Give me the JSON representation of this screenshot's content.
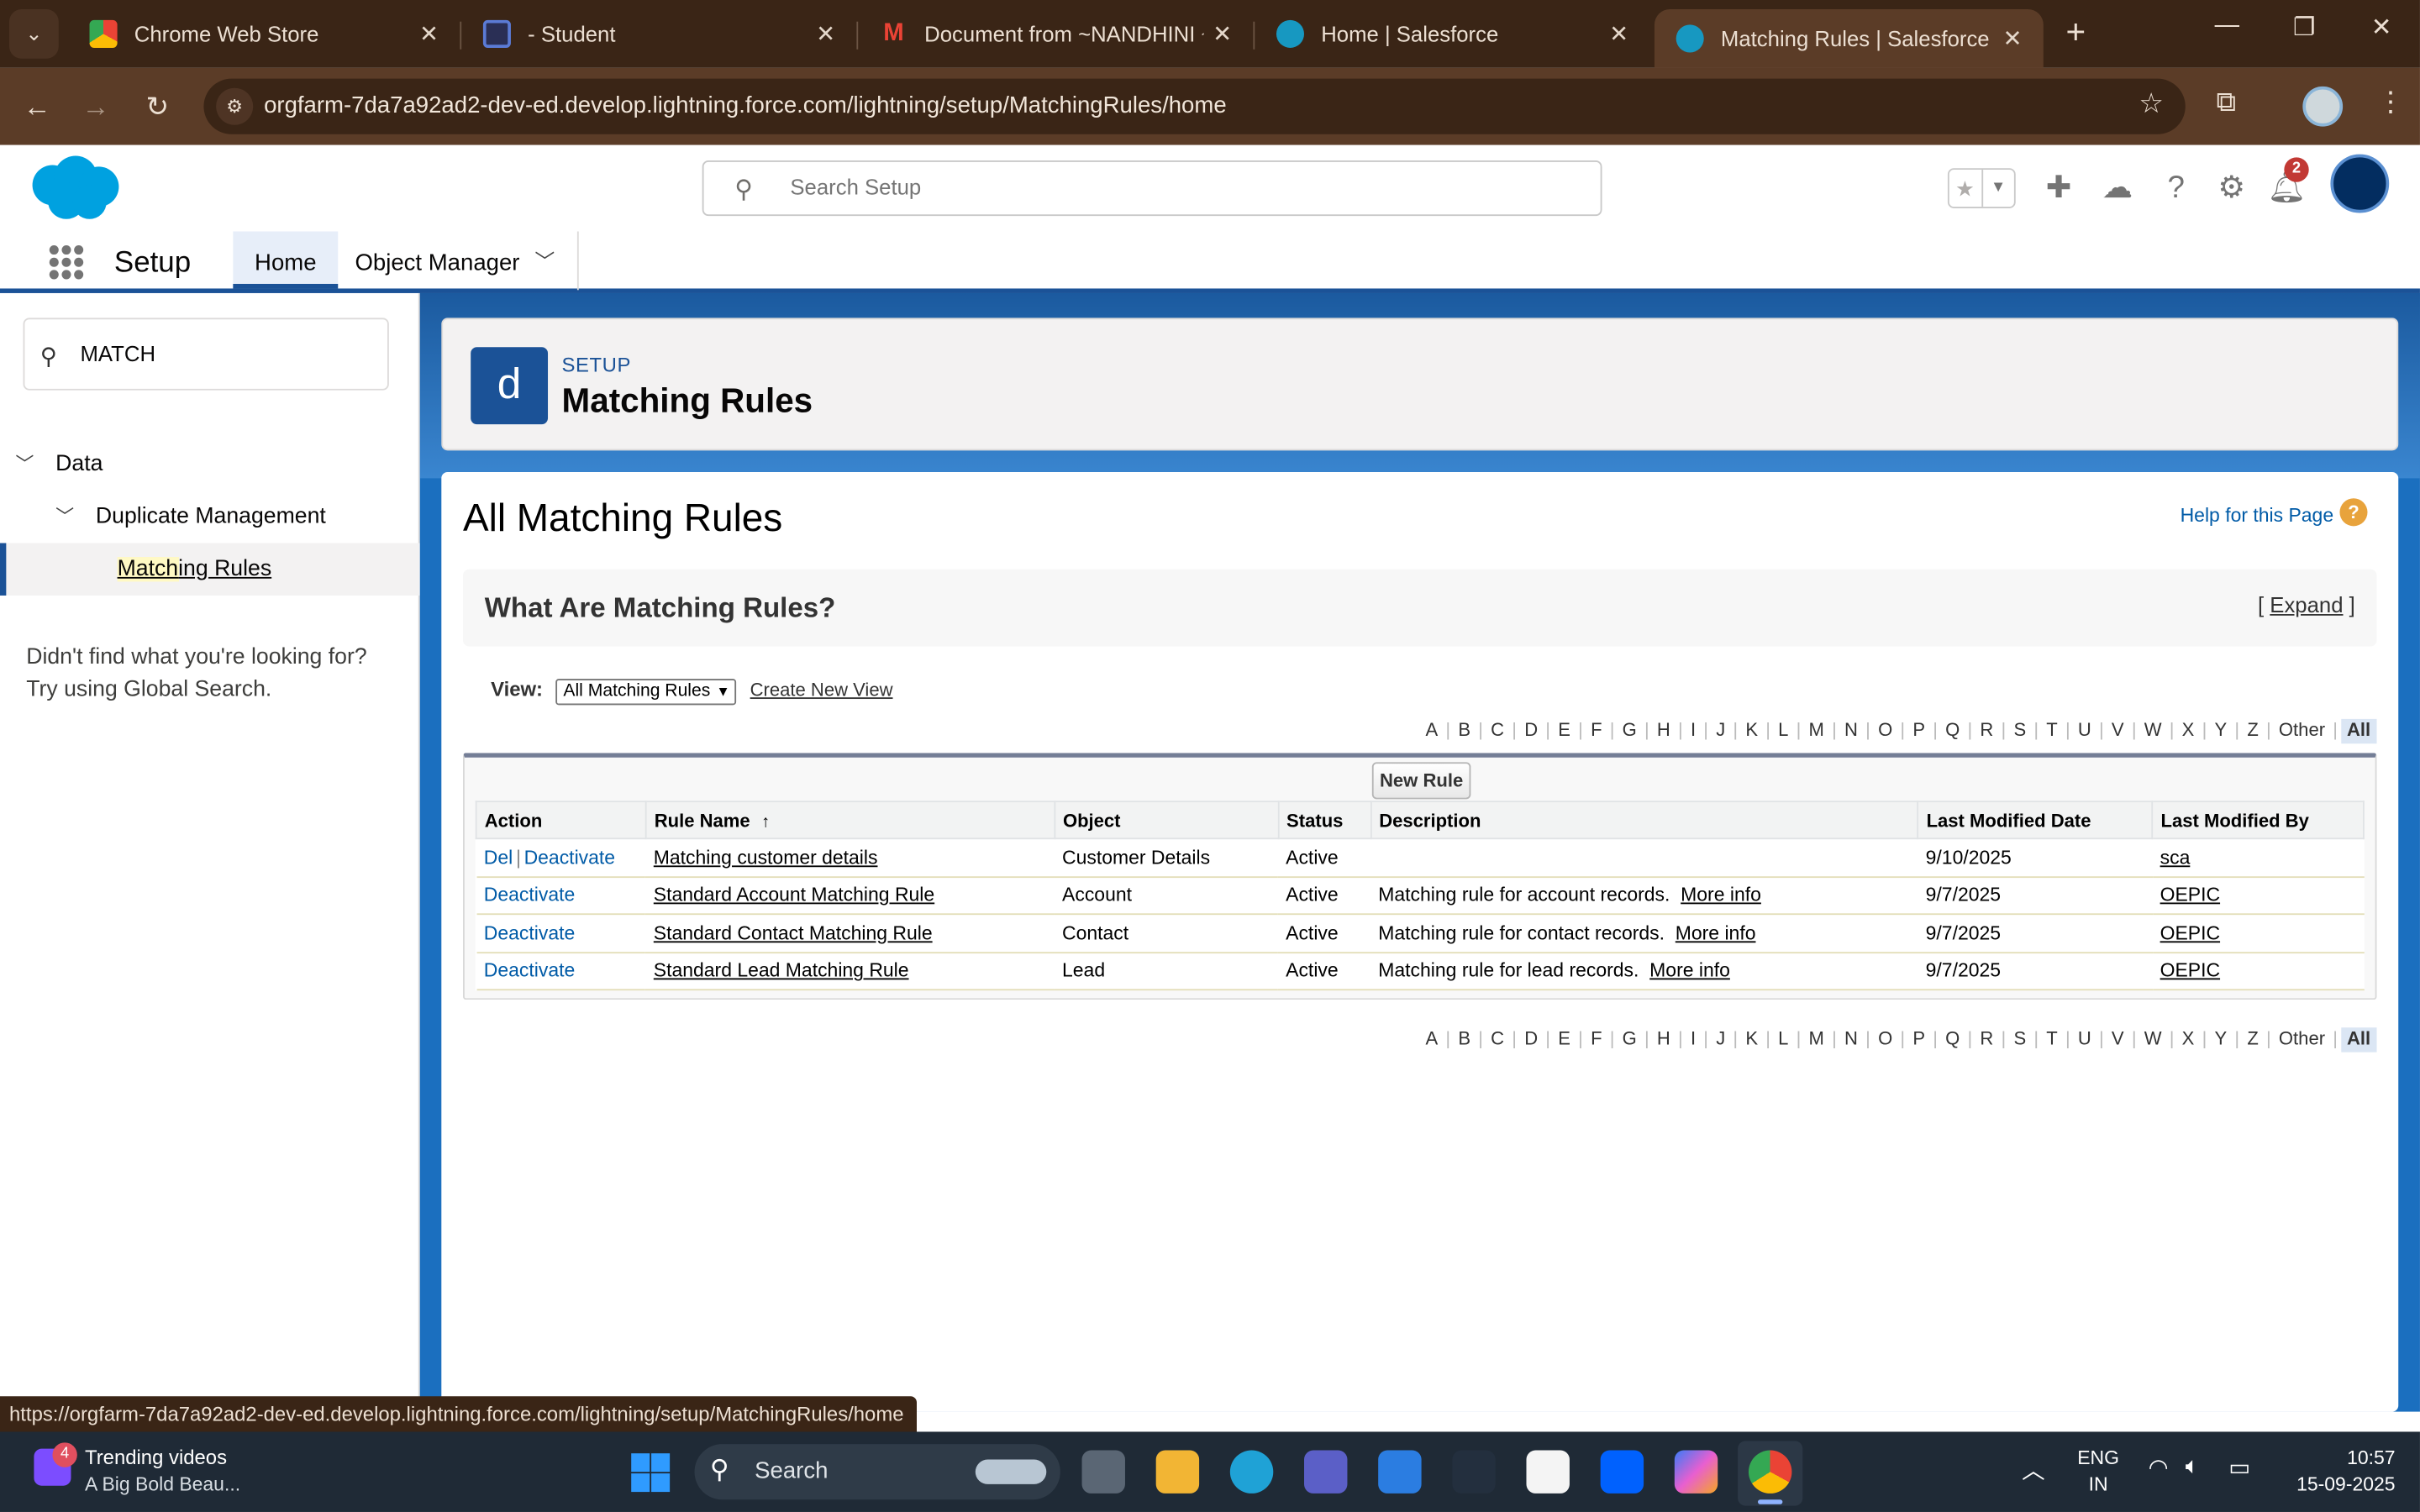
{
  "browser": {
    "tabs": [
      {
        "title": "Chrome Web Store",
        "favicon": "chrome-webstore-icon",
        "active": false
      },
      {
        "title": "- Student",
        "favicon": "student-app-icon",
        "active": false
      },
      {
        "title": "Document from ~NANDHINI ~",
        "favicon": "gmail-icon",
        "active": false
      },
      {
        "title": "Home | Salesforce",
        "favicon": "salesforce-cloud-icon",
        "active": false
      },
      {
        "title": "Matching Rules | Salesforce",
        "favicon": "salesforce-cloud-icon",
        "active": true
      }
    ],
    "url": "orgfarm-7da7a92ad2-dev-ed.develop.lightning.force.com/lightning/setup/MatchingRules/home",
    "status_url": "https://orgfarm-7da7a92ad2-dev-ed.develop.lightning.force.com/lightning/setup/MatchingRules/home"
  },
  "header": {
    "search_placeholder": "Search Setup",
    "notification_count": "2",
    "brand_color": "#1b5297"
  },
  "context_nav": {
    "app_name": "Setup",
    "tabs": [
      {
        "label": "Home",
        "active": true
      },
      {
        "label": "Object Manager",
        "active": false
      }
    ]
  },
  "setup_tree": {
    "quickfind_value": "MATCH",
    "items": [
      {
        "label": "Data",
        "level": 0,
        "expanded": true
      },
      {
        "label": "Duplicate Management",
        "level": 1,
        "expanded": true
      },
      {
        "label_highlight": "Match",
        "label_rest": "ing Rules",
        "level": 2,
        "selected": true
      }
    ],
    "not_found_line1": "Didn't find what you're looking for?",
    "not_found_line2": "Try using Global Search."
  },
  "page_header": {
    "icon_letter": "d",
    "eyebrow": "SETUP",
    "title": "Matching Rules"
  },
  "content": {
    "heading": "All Matching Rules",
    "help_link": "Help for this Page",
    "help_icon": "?",
    "what_are": "What Are Matching Rules?",
    "expand_open": "[ ",
    "expand_label": "Expand",
    "expand_close": " ]",
    "view_label": "View:",
    "view_selected": "All Matching Rules",
    "create_view": "Create New View",
    "alphabet": [
      "A",
      "B",
      "C",
      "D",
      "E",
      "F",
      "G",
      "H",
      "I",
      "J",
      "K",
      "L",
      "M",
      "N",
      "O",
      "P",
      "Q",
      "R",
      "S",
      "T",
      "U",
      "V",
      "W",
      "X",
      "Y",
      "Z",
      "Other",
      "All"
    ],
    "new_rule_button": "New Rule",
    "columns": [
      "Action",
      "Rule Name",
      "Object",
      "Status",
      "Description",
      "Last Modified Date",
      "Last Modified By"
    ],
    "sort_indicator": "↑",
    "rows": [
      {
        "action_del": "Del",
        "action_deactivate": "Deactivate",
        "rule_name": "Matching customer details",
        "object": "Customer Details",
        "status": "Active",
        "description": "",
        "more_info": "",
        "date": "9/10/2025",
        "by": "sca"
      },
      {
        "action_del": "",
        "action_deactivate": "Deactivate",
        "rule_name": "Standard Account Matching Rule",
        "object": "Account",
        "status": "Active",
        "description": "Matching rule for account records.",
        "more_info": "More info",
        "date": "9/7/2025",
        "by": "OEPIC"
      },
      {
        "action_del": "",
        "action_deactivate": "Deactivate",
        "rule_name": "Standard Contact Matching Rule",
        "object": "Contact",
        "status": "Active",
        "description": "Matching rule for contact records.",
        "more_info": "More info",
        "date": "9/7/2025",
        "by": "OEPIC"
      },
      {
        "action_del": "",
        "action_deactivate": "Deactivate",
        "rule_name": "Standard Lead Matching Rule",
        "object": "Lead",
        "status": "Active",
        "description": "Matching rule for lead records.",
        "more_info": "More info",
        "date": "9/7/2025",
        "by": "OEPIC"
      }
    ]
  },
  "taskbar": {
    "widget_badge": "4",
    "widget_title": "Trending videos",
    "widget_sub": "A Big Bold Beau...",
    "search_label": "Search",
    "lang_line1": "ENG",
    "lang_line2": "IN",
    "time": "10:57",
    "date": "15-09-2025"
  }
}
